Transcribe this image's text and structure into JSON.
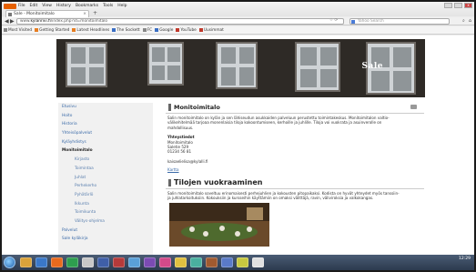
{
  "browser": {
    "menu": [
      "File",
      "Edit",
      "View",
      "History",
      "Bookmarks",
      "Tools",
      "Help"
    ],
    "tab_title": "Sale - Monitoimitalo",
    "new_tab": "+",
    "url_prefix": "www.",
    "url_host": "kylanrivi.fi",
    "url_path": "/index.php?id=monitoimitalo",
    "search_placeholder": "Yahoo Search",
    "bookmarks": [
      "Most Visited",
      "Getting Started",
      "Latest Headlines",
      "The Sockett",
      "FC",
      "Google",
      "YouTube",
      "Uusimmat"
    ]
  },
  "site": {
    "brand": "Sale",
    "sidebar": {
      "items": [
        {
          "label": "Etusivu",
          "level": 0
        },
        {
          "label": "Hoito",
          "level": 0
        },
        {
          "label": "Historia",
          "level": 0
        },
        {
          "label": "Yhteisöpalvelut",
          "level": 0
        },
        {
          "label": "Kyläyhdistys",
          "level": 0
        },
        {
          "label": "Monitoimitalo",
          "level": 0,
          "active": true
        },
        {
          "label": "Kirjasto",
          "level": 1
        },
        {
          "label": "Toimintaa",
          "level": 1
        },
        {
          "label": "Juhlat",
          "level": 1
        },
        {
          "label": "Perhekerho",
          "level": 1
        },
        {
          "label": "Pyhätärlö",
          "level": 1
        },
        {
          "label": "Ikkunta",
          "level": 1
        },
        {
          "label": "Toimikunta",
          "level": 1
        },
        {
          "label": "Välitys-ohjelma",
          "level": 1
        },
        {
          "label": "Palvelut",
          "level": 0
        },
        {
          "label": "Sale kyläkirja",
          "level": 0
        }
      ]
    },
    "main": {
      "section1_title": "Monitoimitalo",
      "section1_text": "Salin monitoimitalo on kylän ja sen lähiseudun asukkaiden palveluun perustettu toimintakeskus. Monitoimitalon valtio-välikehitelmää tarjoaa monenlaisia tiloja kokoontumiseen, kerhoille ja juhlille. Tiloja voi vuokrata ja asuinverolle on mahdollisuus.",
      "contact_title": "Yhteystiedot",
      "contact_lines": [
        "Monitoimitalo",
        "Saletie 529",
        "01234 56 81"
      ],
      "email": "kaisaelielisa@kylalli.fi",
      "map_link": "Kartta",
      "section2_title": "Tilojen vuokraaminen",
      "section2_text": "Salin monitoimitalo soveltuu erinomaisesti perhejuhlien ja kokousten pitopaikaksi. Kodista on hyvät yhteydet myös tanssiin- ja juhlatarkoituksiin. Kokouksiin ja kursseihin käyttämiin on omaksi välittäjä, ravin, väliviroksia ja valkokangas."
    }
  },
  "taskbar": {
    "time": "12:29"
  }
}
